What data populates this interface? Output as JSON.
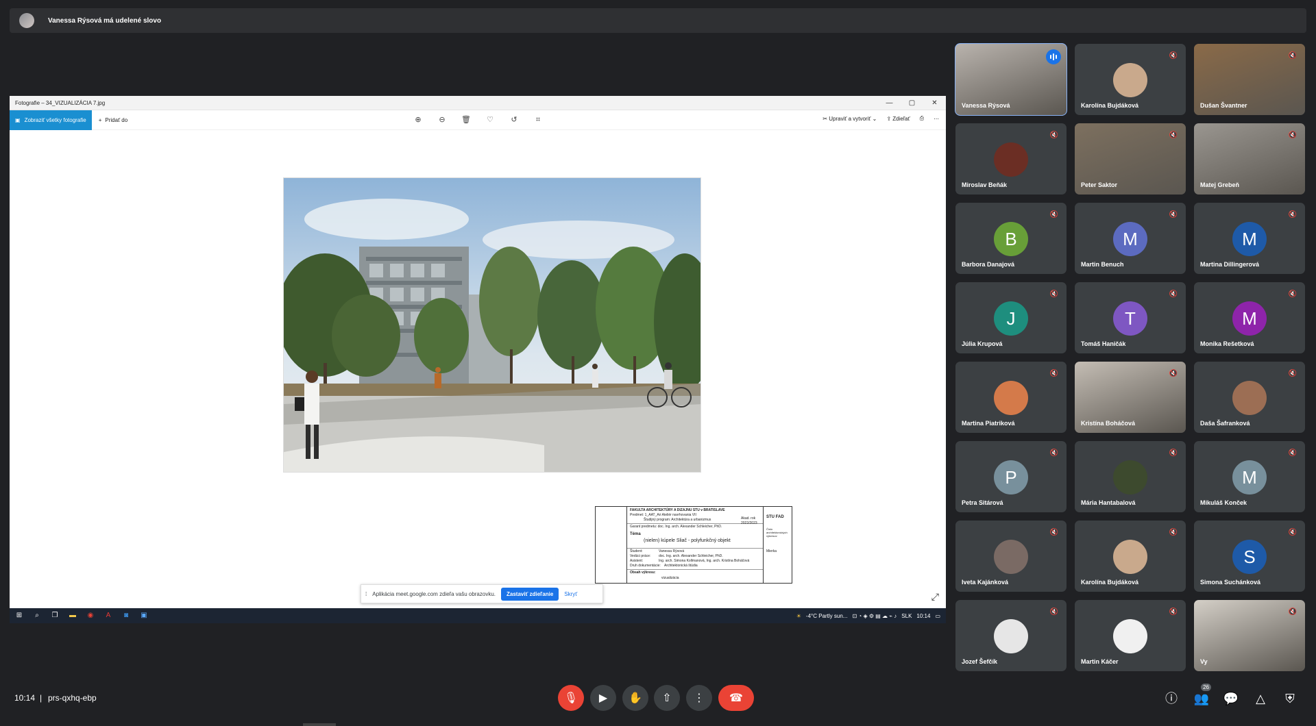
{
  "banner": {
    "text": "Vanessa Rýsová má udelené slovo"
  },
  "photos_app": {
    "window_title": "Fotografie – 34_VIZUALIZÁCIA 7.jpg",
    "window_buttons": [
      "—",
      "▢",
      "✕"
    ],
    "show_all_label": "Zobraziť všetky fotografie",
    "add_to_label": "Pridať do",
    "edit_label": "Upraviť a vytvoriť",
    "share_label": "Zdieľať"
  },
  "titleblock": {
    "school": "FAKULTA ARCHITEKTÚRY A DIZAJNU STU v BRATISLAVE",
    "subject": "Predmet: 1_AAT_Ari Ateliér navrhovania VII",
    "program": "Študijný program: Architektúra a urbanizmus",
    "guarantor": "Garant predmetu: doc. Ing. arch. Alexander Schleicher, PhD.",
    "year_label": "Akad. rok",
    "year": "2022/2023",
    "theme_label": "Téma",
    "theme": "(nielen) kúpele Sliač - polyfunkčný objekt",
    "student_label": "Študent:",
    "student": "Vanessa Rýsová",
    "lead_label": "Vedúci práce:",
    "lead": "doc. Ing. arch. Alexander Schleicher, PhD.",
    "assistant_label": "Asistent:",
    "assistant": "Ing. arch. Simona Kollmanová, Ing. arch. Kristína Boháčová",
    "doc_type_label": "Druh dokumentácie:",
    "doc_type": "Architektonická štúdia",
    "content_label": "Obsah výkresu:",
    "content": "vizualizácia",
    "logo_text": "STU FAD",
    "scale_label": "Mierka",
    "drawing_label": "Číslo architektonických výkresov"
  },
  "share_notice": {
    "text": "Aplikácia meet.google.com zdieľa vašu obrazovku.",
    "stop_label": "Zastaviť zdieľanie",
    "hide_label": "Skryť"
  },
  "taskbar": {
    "weather": "-4°C  Partly sun...",
    "lang": "SLK",
    "time": "10:14"
  },
  "participants": [
    {
      "name": "Vanessa Rýsová",
      "type": "video",
      "bg": "#b9b3ad",
      "speaking": true
    },
    {
      "name": "Karolína Bujdáková",
      "type": "photo",
      "bg": "#c9a98c"
    },
    {
      "name": "Dušan Švantner",
      "type": "video",
      "bg": "#8a6a48"
    },
    {
      "name": "Miroslav Beňák",
      "type": "photo",
      "bg": "#6b2e24"
    },
    {
      "name": "Peter Saktor",
      "type": "video",
      "bg": "#7d705f"
    },
    {
      "name": "Matej Grebeň",
      "type": "video",
      "bg": "#9a9690"
    },
    {
      "name": "Barbora Danajová",
      "type": "letter",
      "letter": "B",
      "bg": "#689f38"
    },
    {
      "name": "Martin Benuch",
      "type": "letter",
      "letter": "M",
      "bg": "#5c6bc0"
    },
    {
      "name": "Martina Dillingerová",
      "type": "letter",
      "letter": "M",
      "bg": "#1e5aa8"
    },
    {
      "name": "Júlia Krupová",
      "type": "letter",
      "letter": "J",
      "bg": "#1e8e7e"
    },
    {
      "name": "Tomáš Haničák",
      "type": "letter",
      "letter": "T",
      "bg": "#7e57c2"
    },
    {
      "name": "Monika Rešetková",
      "type": "letter",
      "letter": "M",
      "bg": "#8e24aa"
    },
    {
      "name": "Martina Piatriková",
      "type": "photo",
      "bg": "#d47a4a"
    },
    {
      "name": "Kristína Boháčová",
      "type": "video",
      "bg": "#c4bdb4"
    },
    {
      "name": "Daša Šafranková",
      "type": "photo",
      "bg": "#9c6e54"
    },
    {
      "name": "Petra Sitárová",
      "type": "letter",
      "letter": "P",
      "bg": "#78909c"
    },
    {
      "name": "Mária Hantabalová",
      "type": "photo",
      "bg": "#3d4a2e"
    },
    {
      "name": "Mikuláš Konček",
      "type": "letter",
      "letter": "M",
      "bg": "#78909c"
    },
    {
      "name": "Iveta Kajánková",
      "type": "photo",
      "bg": "#7a6a64"
    },
    {
      "name": "Karolína Bujdáková",
      "type": "photo",
      "bg": "#c9a98c"
    },
    {
      "name": "Simona Suchánková",
      "type": "letter",
      "letter": "S",
      "bg": "#1e5aa8"
    },
    {
      "name": "Jozef Šefčík",
      "type": "photo",
      "bg": "#e6e6e6"
    },
    {
      "name": "Martin Káčer",
      "type": "photo",
      "bg": "#f0f0f0"
    },
    {
      "name": "Vy",
      "type": "video",
      "bg": "#d4cfc7"
    }
  ],
  "meeting": {
    "time": "10:14",
    "separator": "|",
    "code": "prs-qxhq-ebp",
    "participant_count": "26"
  }
}
